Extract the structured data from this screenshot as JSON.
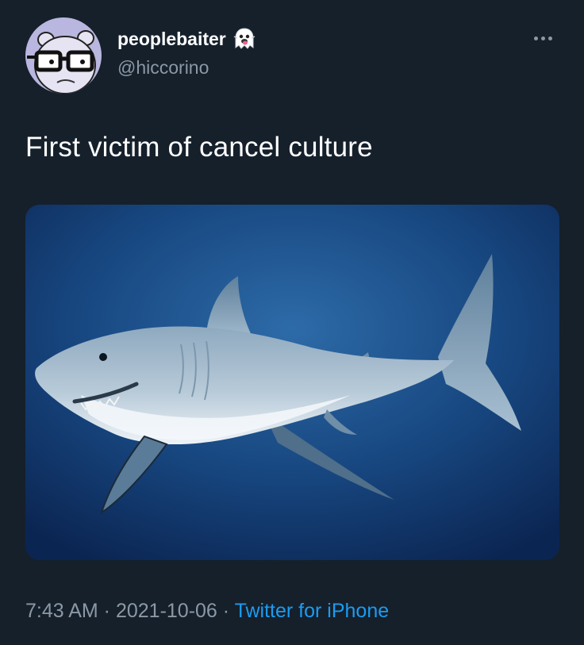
{
  "user": {
    "display_name": "peoplebaiter",
    "handle": "@hiccorino",
    "name_emoji_icon": "ghost-emoji-icon",
    "avatar_icon": "bear-with-glasses-avatar"
  },
  "tweet": {
    "text": "First victim of cancel culture",
    "media_description_icon": "great-white-shark-photo"
  },
  "meta": {
    "time": "7:43 AM",
    "separator": " · ",
    "date": "2021-10-06",
    "source": "Twitter for iPhone"
  },
  "colors": {
    "background": "#15202b",
    "text_primary": "#ffffff",
    "text_secondary": "#8b98a5",
    "link": "#1d9bf0"
  },
  "more_menu_icon": "ellipsis-icon"
}
